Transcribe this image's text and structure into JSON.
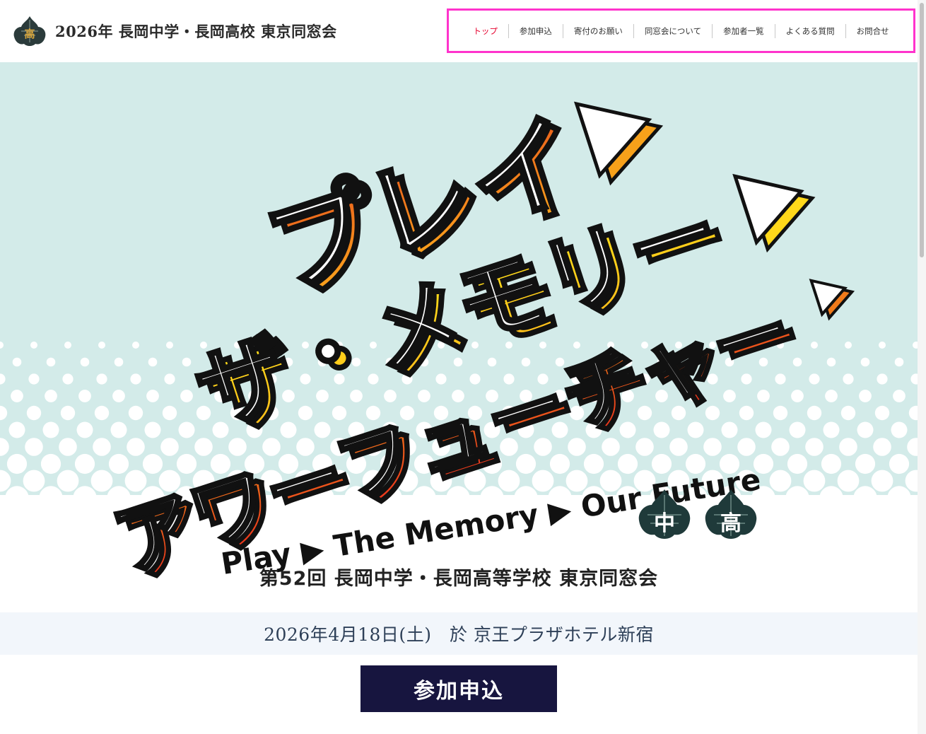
{
  "header": {
    "site_title": "2026年 長岡中学・長岡高校 東京同窓会",
    "logo_char": "高"
  },
  "nav": {
    "items": [
      {
        "label": "トップ",
        "active": true
      },
      {
        "label": "参加申込",
        "active": false
      },
      {
        "label": "寄付のお願い",
        "active": false
      },
      {
        "label": "同窓会について",
        "active": false
      },
      {
        "label": "参加者一覧",
        "active": false
      },
      {
        "label": "よくある質問",
        "active": false
      },
      {
        "label": "お問合せ",
        "active": false
      }
    ]
  },
  "hero": {
    "line1": "プレイ",
    "line2": "ザ・メモリー",
    "line3": "アワーフューチャー",
    "english": "Play ▶ The Memory ▶ Our Future",
    "emblem1": "中",
    "emblem2": "高"
  },
  "event": {
    "title": "第52回 長岡中学・長岡高等学校 東京同窓会",
    "date": "2026年4月18日(土)　於 京王プラザホテル新宿",
    "cta_label": "参加申込"
  },
  "colors": {
    "nav_highlight": "#ff33cc",
    "active_nav": "#e6002d",
    "hero_bg": "#d3ebe9",
    "cta_bg": "#17153f",
    "orange": "#f07a1a",
    "yellow": "#ffd21a",
    "emblem": "#1f3a3a"
  }
}
